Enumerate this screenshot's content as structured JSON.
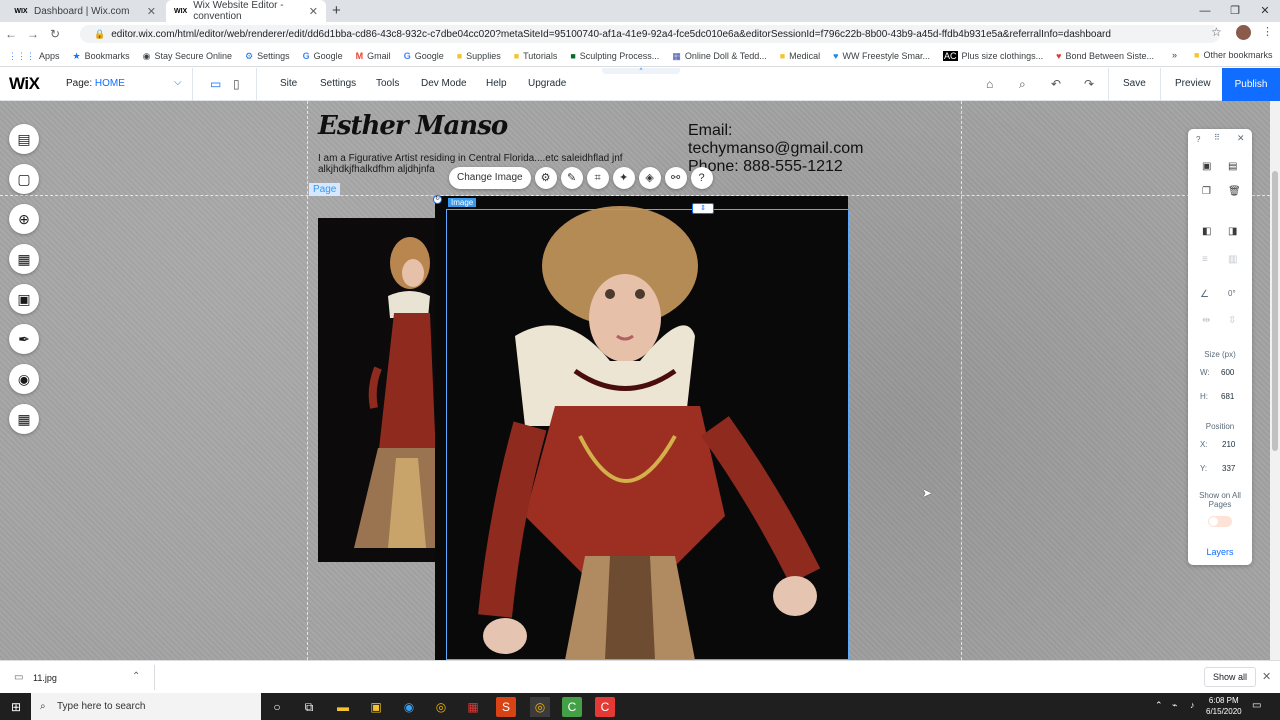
{
  "browser": {
    "tabs": [
      {
        "favicon": "WIX",
        "label": "Dashboard | Wix.com"
      },
      {
        "favicon": "WIX",
        "label": "Wix Website Editor - convention"
      }
    ],
    "url": "editor.wix.com/html/editor/web/renderer/edit/dd6d1bba-cd86-43c8-932c-c7dbe04cc020?metaSiteId=95100740-af1a-41e9-92a4-fce5dc010e6a&editorSessionId=f796c22b-8b00-43b9-a45d-ffdb4b931e5a&referralInfo=dashboard",
    "bookmarks": [
      "Apps",
      "Bookmarks",
      "Stay Secure Online",
      "Settings",
      "Google",
      "Gmail",
      "Google",
      "Supplies",
      "Tutorials",
      "Sculpting Process...",
      "Online Doll & Tedd...",
      "Medical",
      "WW Freestyle Smar...",
      "Plus size clothings...",
      "Bond Between Siste..."
    ],
    "other_bookmarks": "Other bookmarks",
    "more": "»"
  },
  "editor": {
    "logo": "WiX",
    "page_prefix": "Page:",
    "page_name": "HOME",
    "menu": [
      "Site",
      "Settings",
      "Tools",
      "Dev Mode",
      "Help",
      "Upgrade"
    ],
    "save": "Save",
    "preview": "Preview",
    "publish": "Publish"
  },
  "site": {
    "title": "Esther Manso",
    "description": "I am a Figurative Artist residing in Central Florida....etc saleidhflad jnf alkjhdkjfhalkdfhm aljdhjnfa",
    "email_label": "Email:",
    "email": "techymanso@gmail.com",
    "phone": "Phone:  888-555-1212",
    "page_tag": "Page"
  },
  "image_toolbar": {
    "change_image": "Change Image",
    "tag": "Image"
  },
  "inspector": {
    "rotation": "0°",
    "size_label": "Size (px)",
    "w_label": "W:",
    "w": "600",
    "h_label": "H:",
    "h": "681",
    "position_label": "Position",
    "x_label": "X:",
    "x": "210",
    "y_label": "Y:",
    "y": "337",
    "show_all": "Show on All Pages",
    "layers": "Layers",
    "help": "?"
  },
  "download": {
    "file": "11.jpg",
    "show_all": "Show all"
  },
  "taskbar": {
    "search_placeholder": "Type here to search",
    "time": "6:08 PM",
    "date": "6/15/2020"
  }
}
